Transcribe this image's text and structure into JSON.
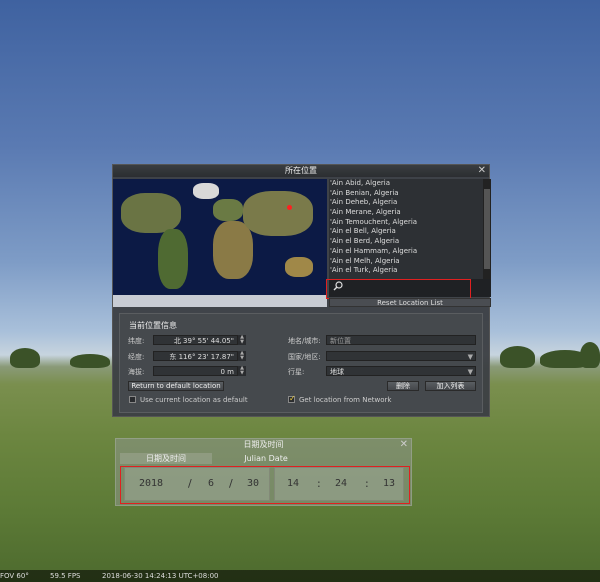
{
  "location_window": {
    "title": "所在位置",
    "close_symbol": "✕",
    "cities": [
      "'Ain Abid, Algeria",
      "'Ain Benian, Algeria",
      "'Ain Deheb, Algeria",
      "'Ain Merane, Algeria",
      "'Ain Temouchent, Algeria",
      "'Ain el Bell, Algeria",
      "'Ain el Berd, Algeria",
      "'Ain el Hammam, Algeria",
      "'Ain el Melh, Algeria",
      "'Ain el Turk, Algeria"
    ],
    "reset_label": "Reset Location List",
    "info_title": "当前位置信息",
    "latitude_label": "纬度:",
    "latitude_value": "北 39° 55' 44.05\"",
    "longitude_label": "经度:",
    "longitude_value": "东 116° 23' 17.87\"",
    "altitude_label": "海拔:",
    "altitude_value": "0 m",
    "name_label": "地名/城市:",
    "name_value": "新位置",
    "country_label": "国家/地区:",
    "country_value": "",
    "planet_label": "行星:",
    "planet_value": "地球",
    "return_default_label": "Return to default location",
    "delete_label": "删除",
    "add_label": "加入列表",
    "use_default_label": "Use current location as default",
    "use_default_checked": false,
    "network_label": "Get location from Network",
    "network_checked": true
  },
  "date_window": {
    "title": "日期及时间",
    "close_symbol": "✕",
    "tabs": [
      "日期及时间",
      "Julian Date"
    ],
    "year": "2018",
    "month": "6",
    "day": "30",
    "hour": "14",
    "minute": "24",
    "second": "13",
    "date_sep": "/",
    "time_sep": ":"
  },
  "status_bar": {
    "fov": "FOV 60°",
    "fps": "59.5 FPS",
    "datetime": "2018-06-30   14:24:13 UTC+08:00"
  },
  "colors": {
    "highlight_box": "#e02020",
    "window_bg": "#3c4044",
    "checkmark": "#f0d040"
  }
}
